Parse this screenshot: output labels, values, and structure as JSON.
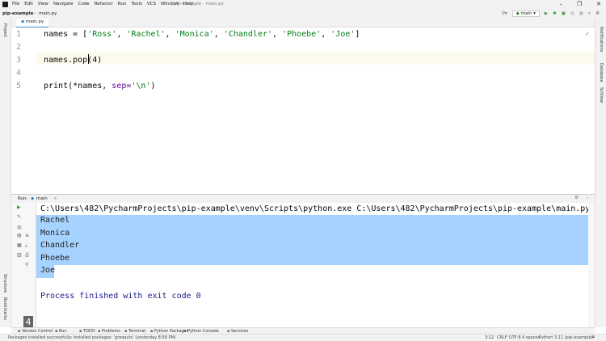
{
  "menubar": {
    "items": [
      "File",
      "Edit",
      "View",
      "Navigate",
      "Code",
      "Refactor",
      "Run",
      "Tools",
      "VCS",
      "Window",
      "Help"
    ],
    "title": "pip-example - main.py",
    "controls": [
      "–",
      "❐",
      "✕"
    ]
  },
  "navbar": {
    "project": "pip-example",
    "file": "main.py",
    "run_config": "main"
  },
  "tabs": [
    {
      "label": "main.py"
    }
  ],
  "right_strip": [
    "Notifications",
    "Database",
    "SciView"
  ],
  "left_strip": [
    "Project",
    "Structure",
    "Bookmarks"
  ],
  "editor": {
    "line_numbers": [
      "1",
      "2",
      "3",
      "4",
      "5"
    ],
    "lines": [
      {
        "parts": [
          {
            "t": "names = [",
            "c": ""
          },
          {
            "t": "'Ross'",
            "c": "str"
          },
          {
            "t": ", ",
            "c": ""
          },
          {
            "t": "'Rachel'",
            "c": "str"
          },
          {
            "t": ", ",
            "c": ""
          },
          {
            "t": "'Monica'",
            "c": "str"
          },
          {
            "t": ", ",
            "c": ""
          },
          {
            "t": "'Chandler'",
            "c": "str"
          },
          {
            "t": ", ",
            "c": ""
          },
          {
            "t": "'Phoebe'",
            "c": "str"
          },
          {
            "t": ", ",
            "c": ""
          },
          {
            "t": "'Joe'",
            "c": "str"
          },
          {
            "t": "]",
            "c": ""
          }
        ]
      },
      {
        "parts": []
      },
      {
        "parts": [
          {
            "t": "names.pop(4)",
            "c": ""
          }
        ]
      },
      {
        "parts": []
      },
      {
        "parts": [
          {
            "t": "print(*names, ",
            "c": ""
          },
          {
            "t": "sep=",
            "c": "param"
          },
          {
            "t": "'\\n'",
            "c": "str"
          },
          {
            "t": ")",
            "c": ""
          }
        ]
      }
    ]
  },
  "run": {
    "label": "Run:",
    "tab": "main",
    "command": "C:\\Users\\482\\PycharmProjects\\pip-example\\venv\\Scripts\\python.exe C:\\Users\\482\\PycharmProjects\\pip-example\\main.py",
    "output": [
      "Rachel",
      "Monica",
      "Chandler",
      "Phoebe",
      "Joe"
    ],
    "exit_message": "Process finished with exit code 0"
  },
  "toolwindows": [
    "Version Control",
    "Run",
    "TODO",
    "Problems",
    "Terminal",
    "Python Packages",
    "Python Console",
    "Services"
  ],
  "status": {
    "message": "Packages installed successfully: Installed packages: 'greqauts' (yesterday 8:58 PM)",
    "position": "3:12",
    "line_sep": "CRLF",
    "encoding": "UTF-8",
    "indent": "4 spaces",
    "interpreter": "Python 3.11 (pip-example)"
  },
  "badge": "4"
}
